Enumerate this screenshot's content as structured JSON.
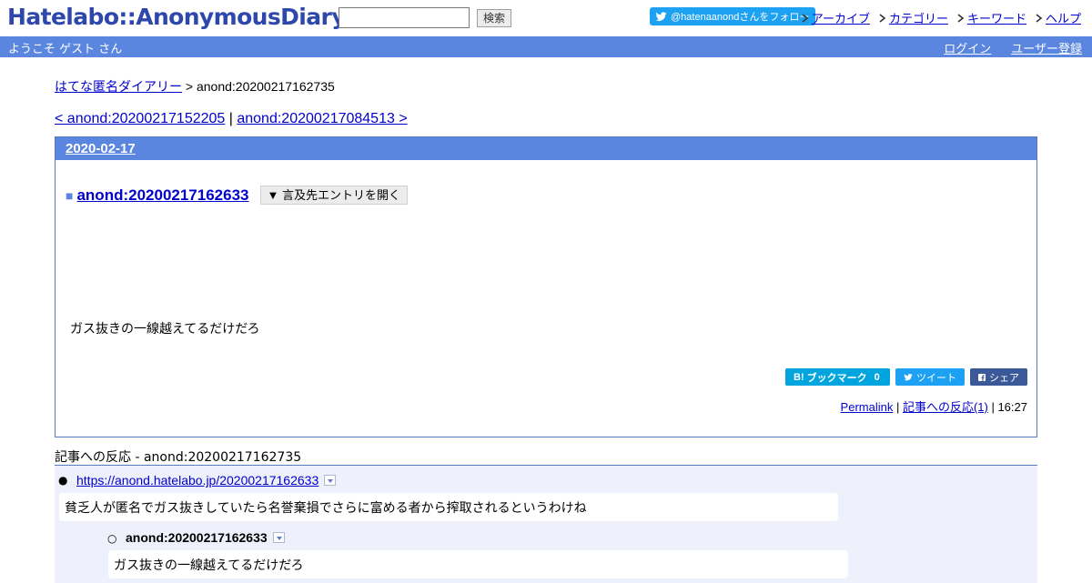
{
  "header": {
    "logo": "Hatelabo::AnonymousDiary",
    "search_value": "",
    "search_button": "検索",
    "twitter_follow": "@hatenaanondさんをフォロー",
    "links": [
      "アーカイブ",
      "カテゴリー",
      "キーワード",
      "ヘルプ"
    ]
  },
  "navbar": {
    "welcome": "ようこそ ゲスト さん",
    "login": "ログイン",
    "register": "ユーザー登録"
  },
  "breadcrumb": {
    "root": "はてな匿名ダイアリー",
    "separator": " > ",
    "current": "anond:20200217162735"
  },
  "pager": {
    "prev": "< anond:20200217152205",
    "separator": " | ",
    "next": "anond:20200217084513 >"
  },
  "day": {
    "date": "2020-02-17",
    "entry": {
      "square": "■",
      "title": "anond:20200217162633",
      "open_button": "▼ 言及先エントリを開く",
      "body": "ガス抜きの一線越えてるだけだろ",
      "share": {
        "bookmark": "ブックマーク",
        "bookmark_count": "0",
        "tweet": "ツイート",
        "share": "シェア"
      },
      "footer": {
        "permalink": "Permalink",
        "sep1": " | ",
        "reactions_link": "記事への反応(1)",
        "sep2": " | ",
        "time": "16:27"
      }
    }
  },
  "reactions": {
    "title": "記事への反応 - anond:20200217162735",
    "items": [
      {
        "link": "https://anond.hatelabo.jp/20200217162633",
        "comment": "貧乏人が匿名でガス抜きしていたら名誉棄損でさらに富める者から搾取されるというわけね",
        "children": [
          {
            "title": "anond:20200217162633",
            "comment": "ガス抜きの一線越えてるだけだろ"
          }
        ]
      }
    ]
  },
  "colors": {
    "bar": "#5a86e0",
    "logo": "#2d47ad",
    "link": "#0000cc",
    "twitter": "#1da1f2",
    "hatena": "#00a4de",
    "facebook": "#3b5998",
    "reaction_bg": "#eef1fb"
  }
}
